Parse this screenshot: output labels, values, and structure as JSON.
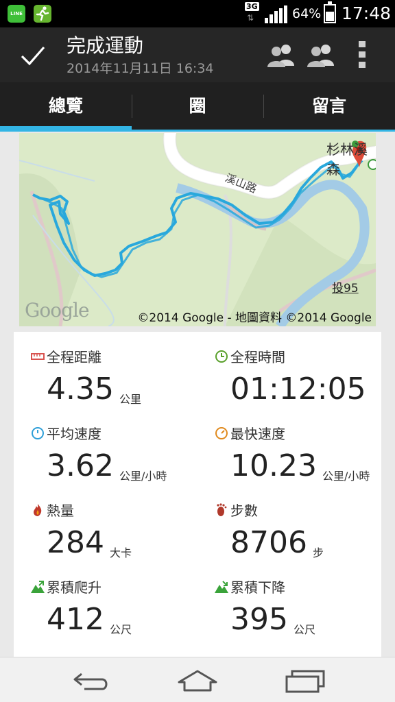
{
  "statusbar": {
    "line_app_text": "LINE",
    "network": "3G",
    "battery": "64%",
    "time": "17:48"
  },
  "header": {
    "title": "完成運動",
    "subtitle": "2014年11月11日 16:34"
  },
  "tabs": [
    {
      "label": "總覽",
      "active": true
    },
    {
      "label": "圈",
      "active": false
    },
    {
      "label": "留言",
      "active": false
    }
  ],
  "map": {
    "road_label": "溪山路",
    "poi_label": "杉林溪森",
    "route_label": "投95",
    "logo": "Google",
    "attribution": "©2014 Google - 地圖資料 ©2014 Google"
  },
  "stats": {
    "distance": {
      "label": "全程距離",
      "value": "4.35",
      "unit": "公里",
      "icon": "ruler-icon",
      "color": "#d9534f"
    },
    "duration": {
      "label": "全程時間",
      "value": "01:12:05",
      "unit": "",
      "icon": "clock-icon",
      "color": "#5aa02c"
    },
    "avg_speed": {
      "label": "平均速度",
      "value": "3.62",
      "unit": "公里/小時",
      "icon": "speedometer-icon",
      "color": "#2f9fd8"
    },
    "max_speed": {
      "label": "最快速度",
      "value": "10.23",
      "unit": "公里/小時",
      "icon": "speedometer-fast-icon",
      "color": "#e08a1e"
    },
    "calories": {
      "label": "熱量",
      "value": "284",
      "unit": "大卡",
      "icon": "flame-icon",
      "color": "#c0392b"
    },
    "steps": {
      "label": "步數",
      "value": "8706",
      "unit": "步",
      "icon": "footprint-icon",
      "color": "#b0392b"
    },
    "ascent": {
      "label": "累積爬升",
      "value": "412",
      "unit": "公尺",
      "icon": "mountain-up-icon",
      "color": "#3aa33a"
    },
    "descent": {
      "label": "累積下降",
      "value": "395",
      "unit": "公尺",
      "icon": "mountain-down-icon",
      "color": "#3aa33a"
    }
  },
  "colors": {
    "accent": "#33b5e5",
    "route": "#29a8dc",
    "map_bg": "#dceac8",
    "header_bg": "#262626"
  }
}
